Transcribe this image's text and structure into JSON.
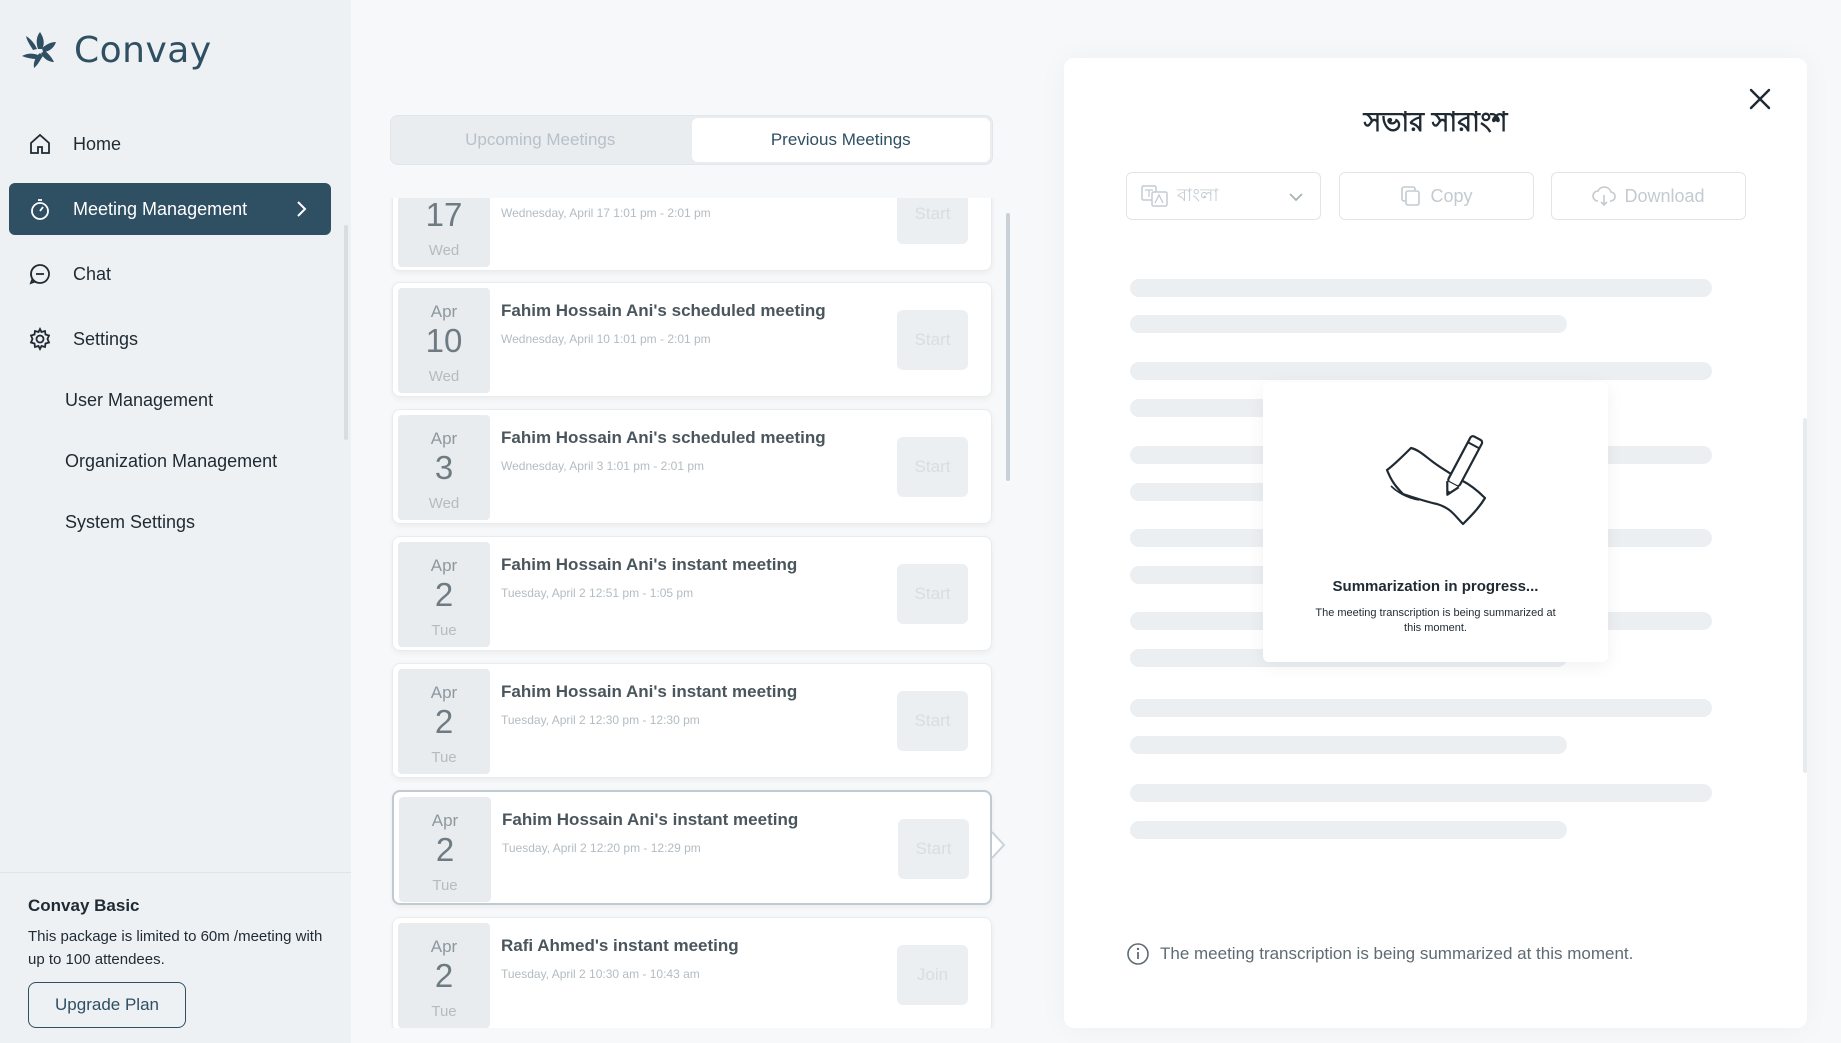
{
  "app": {
    "name": "Convay"
  },
  "sidebar": {
    "nav": [
      {
        "label": "Home",
        "icon": "home-icon"
      },
      {
        "label": "Meeting Management",
        "icon": "stopwatch-icon",
        "active": true
      },
      {
        "label": "Chat",
        "icon": "chat-icon"
      },
      {
        "label": "Settings",
        "icon": "gear-icon"
      }
    ],
    "sub_items": [
      "User Management",
      "Organization Management",
      "System Settings"
    ],
    "plan": {
      "title": "Convay Basic",
      "description": "This package is limited to 60m /meeting with up to 100 attendees.",
      "upgrade_label": "Upgrade Plan"
    }
  },
  "meetings": {
    "tabs": [
      {
        "label": "Upcoming Meetings",
        "active": false
      },
      {
        "label": "Previous Meetings",
        "active": true
      }
    ],
    "items": [
      {
        "month": "",
        "day": "17",
        "weekday": "Wed",
        "title": "",
        "time": "Wednesday, April 17 1:01 pm - 2:01 pm",
        "action": "Start"
      },
      {
        "month": "Apr",
        "day": "10",
        "weekday": "Wed",
        "title": "Fahim Hossain Ani's scheduled meeting",
        "time": "Wednesday, April 10 1:01 pm - 2:01 pm",
        "action": "Start"
      },
      {
        "month": "Apr",
        "day": "3",
        "weekday": "Wed",
        "title": "Fahim Hossain Ani's scheduled meeting",
        "time": "Wednesday, April 3 1:01 pm - 2:01 pm",
        "action": "Start"
      },
      {
        "month": "Apr",
        "day": "2",
        "weekday": "Tue",
        "title": "Fahim Hossain Ani's instant meeting",
        "time": "Tuesday, April 2 12:51 pm - 1:05 pm",
        "action": "Start"
      },
      {
        "month": "Apr",
        "day": "2",
        "weekday": "Tue",
        "title": "Fahim Hossain Ani's instant meeting",
        "time": "Tuesday, April 2 12:30 pm - 12:30 pm",
        "action": "Start"
      },
      {
        "month": "Apr",
        "day": "2",
        "weekday": "Tue",
        "title": "Fahim Hossain Ani's instant meeting",
        "time": "Tuesday, April 2 12:20 pm - 12:29 pm",
        "action": "Start",
        "selected": true
      },
      {
        "month": "Apr",
        "day": "2",
        "weekday": "Tue",
        "title": "Rafi Ahmed's instant meeting",
        "time": "Tuesday, April 2 10:30 am - 10:43 am",
        "action": "Join"
      }
    ]
  },
  "summary_panel": {
    "title": "সভার সারাংশ",
    "language": "বাংলা",
    "copy_label": "Copy",
    "download_label": "Download",
    "progress_title": "Summarization in progress...",
    "progress_desc": "The meeting transcription is being summarized at this moment.",
    "footer_info": "The meeting transcription is being summarized at this moment."
  },
  "colors": {
    "brand": "#2f4f63",
    "sidebar_bg": "#eef1f4",
    "panel_bg": "#ffffff"
  }
}
